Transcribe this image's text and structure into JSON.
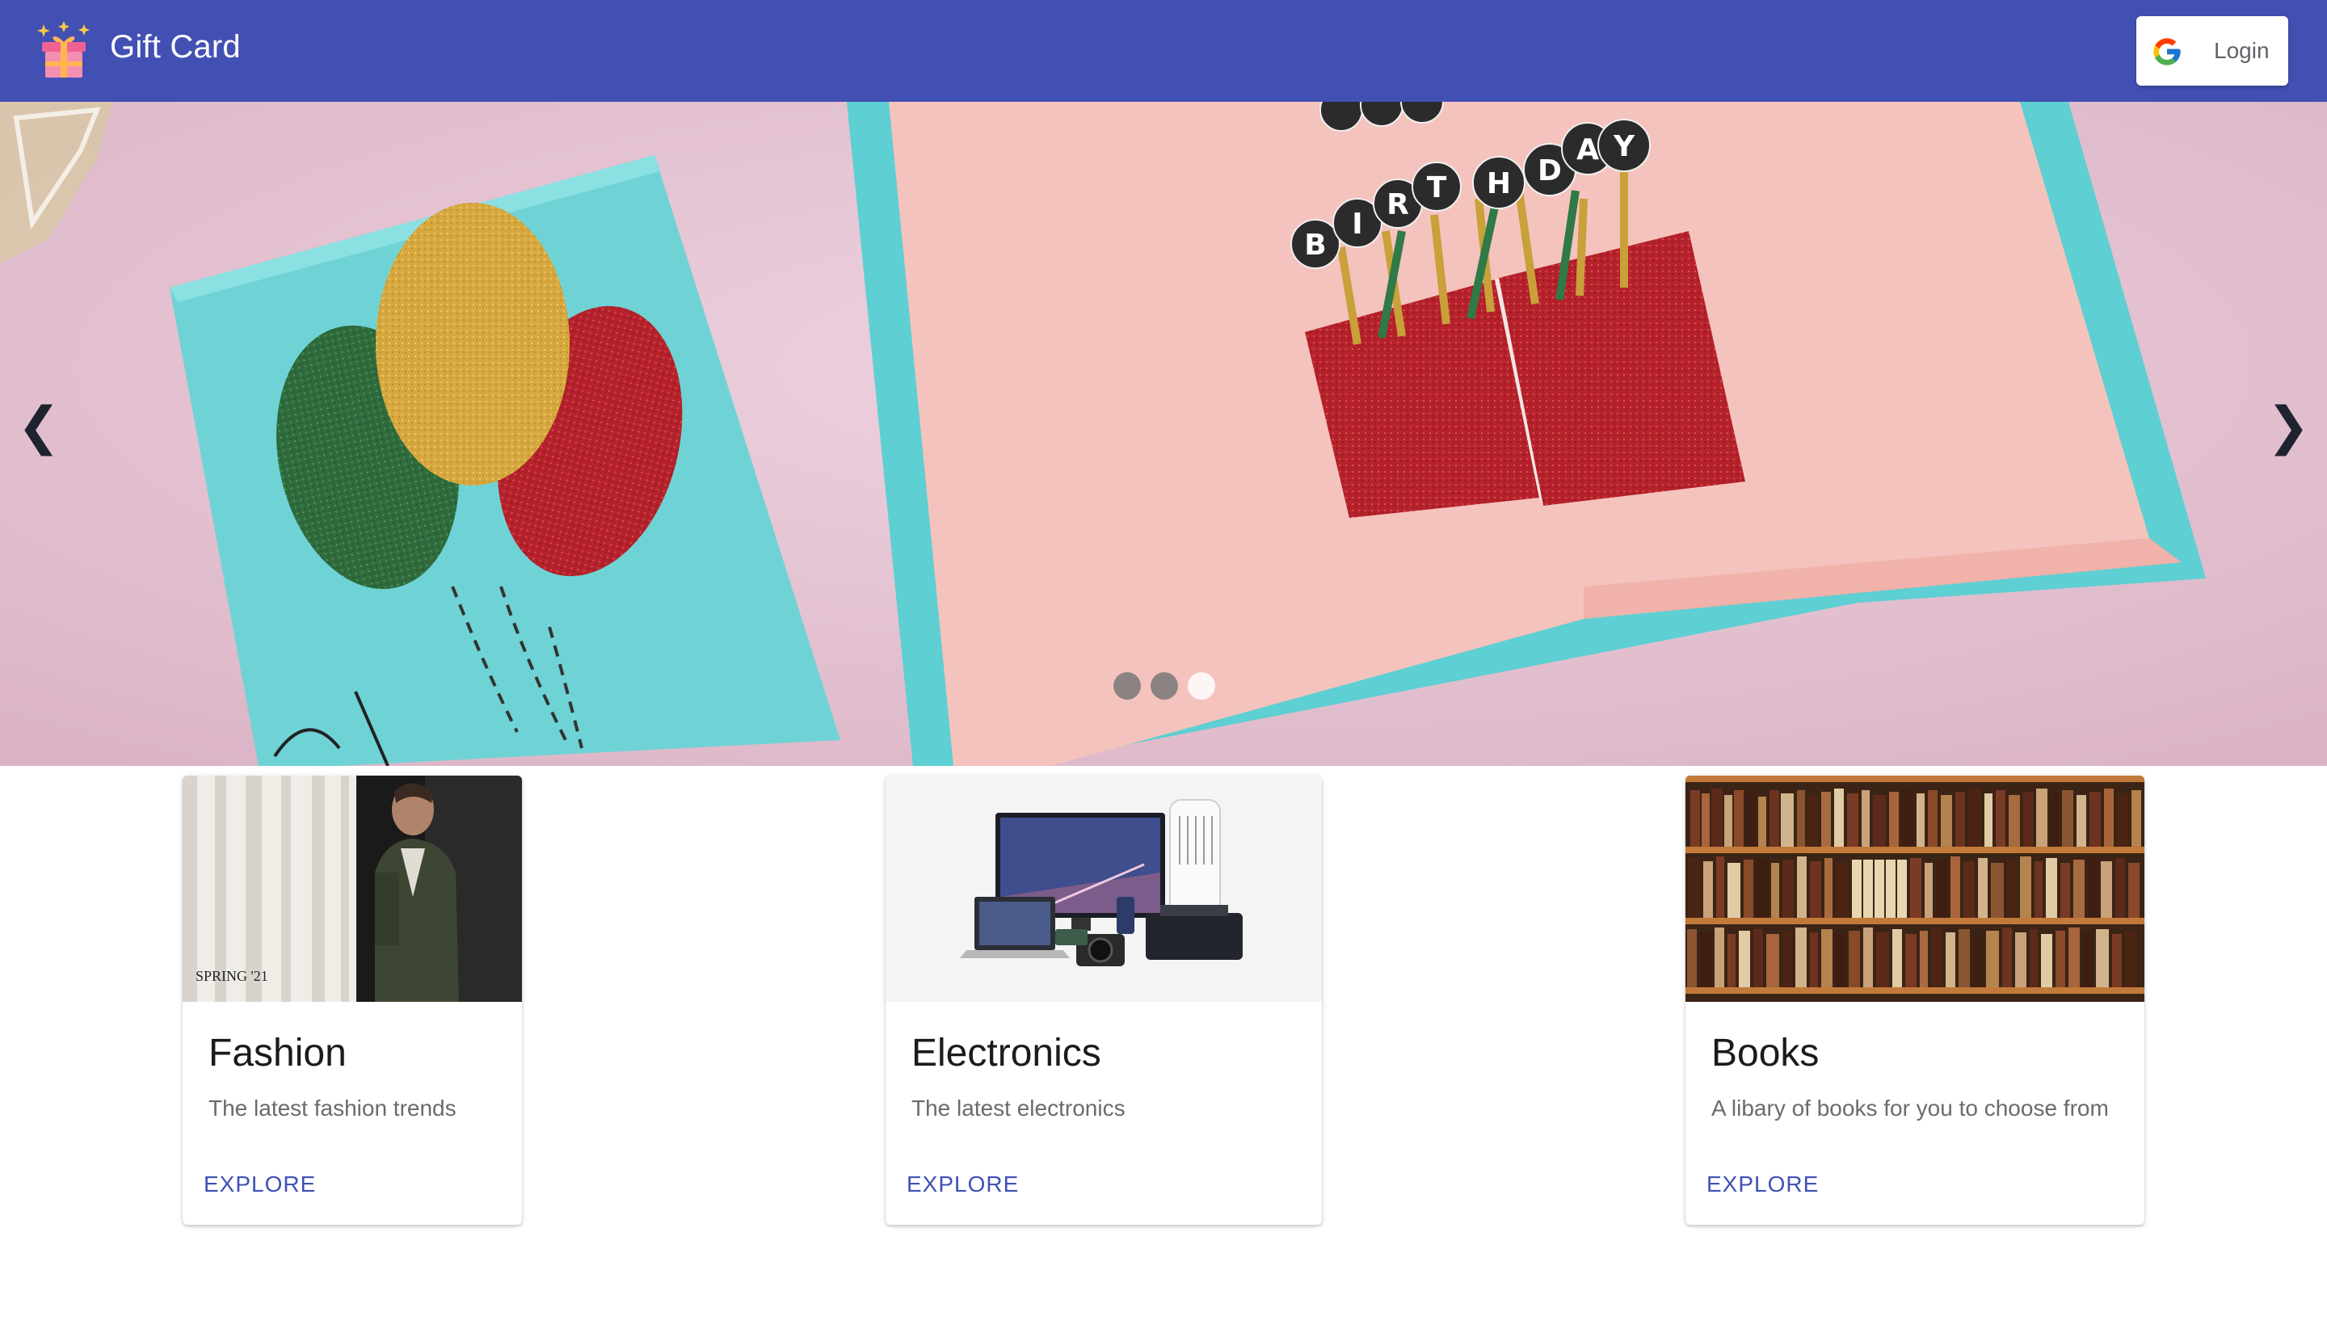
{
  "appbar": {
    "title": "Gift Card",
    "logo_icon": "gift-icon",
    "login": {
      "label": "Login",
      "icon": "google-g-icon"
    },
    "color": "#4350b3"
  },
  "carousel": {
    "prev_icon": "chevron-left-icon",
    "next_icon": "chevron-right-icon",
    "prev_glyph": "❮",
    "next_glyph": "❯",
    "slide_count": 3,
    "active_index": 2,
    "slide_card_text": "HAPPY BIRTHDAY"
  },
  "cards": [
    {
      "title": "Fashion",
      "description": "The latest fashion trends",
      "action": "EXPLORE",
      "image_caption": "SPRING '21"
    },
    {
      "title": "Electronics",
      "description": "The latest electronics",
      "action": "EXPLORE"
    },
    {
      "title": "Books",
      "description": "A libary of books for you to choose from",
      "action": "EXPLORE"
    }
  ],
  "colors": {
    "accent": "#3f51b5",
    "appbar": "#4350b3"
  }
}
